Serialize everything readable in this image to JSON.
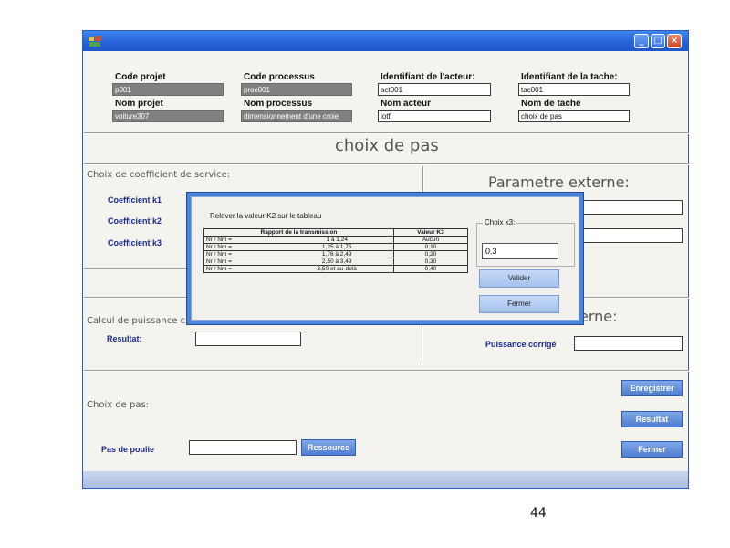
{
  "header": {
    "code_projet": {
      "label": "Code projet",
      "value": "p001"
    },
    "nom_projet": {
      "label": "Nom projet",
      "value": "voiture307"
    },
    "code_processus": {
      "label": "Code processus",
      "value": "proc001"
    },
    "nom_processus": {
      "label": "Nom processus",
      "value": "dimensionnement d'une croie"
    },
    "id_acteur": {
      "label": "Identifiant de l'acteur:",
      "value": "act001"
    },
    "nom_acteur": {
      "label": "Nom acteur",
      "value": "lotfi"
    },
    "id_tache": {
      "label": "Identifiant de la tache:",
      "value": "tac001"
    },
    "nom_tache": {
      "label": "Nom de tache",
      "value": "choix de pas"
    }
  },
  "page_title": "choix de pas",
  "service": {
    "title": "Choix de coefficient de service:",
    "k1_label": "Coefficient k1",
    "k2_label": "Coefficient k2",
    "k3_label": "Coefficient k3"
  },
  "externe": {
    "title": "Parametre externe:",
    "title2_partial": "erne:",
    "puissance_label": "Puissance corrigé"
  },
  "puissance": {
    "title_partial": "Calcul de puissance c",
    "resultat_label": "Resultat:"
  },
  "pas": {
    "title": "Choix de pas:",
    "poulie_label": "Pas de poulie",
    "ressource_btn": "Ressource"
  },
  "buttons": {
    "enregistrer": "Enregistrer",
    "resultat": "Resultat",
    "fermer": "Fermer"
  },
  "window": {
    "minimize": "_",
    "maximize": "□",
    "close": "×"
  },
  "dialog": {
    "instruction": "Relever la valeur K2 sur le tableau",
    "table": {
      "headers": [
        "Rapport de la transmission",
        "Valeur K3"
      ],
      "rows": [
        {
          "lhs": "Nr / Nm =",
          "range": "1 à 1,24",
          "value": "Aucun"
        },
        {
          "lhs": "Nr / Nm =",
          "range": "1,25 à 1,75",
          "value": "0,10"
        },
        {
          "lhs": "Nr / Nm =",
          "range": "1,76 à 2,49",
          "value": "0,20"
        },
        {
          "lhs": "Nr / Nm =",
          "range": "2,50 à 3,49",
          "value": "0,30"
        },
        {
          "lhs": "Nr / Nm =",
          "range": "3,50 et au-delà",
          "value": "0,40"
        }
      ]
    },
    "group_label": "Choix k3:",
    "k3_value": "0.3",
    "valider": "Valider",
    "fermer": "Fermer"
  },
  "page_number": "44"
}
